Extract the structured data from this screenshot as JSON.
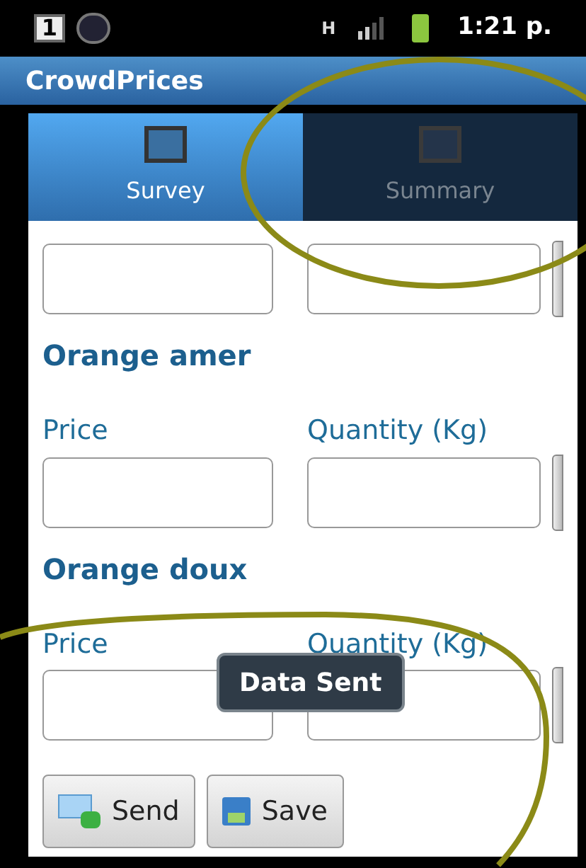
{
  "status_bar": {
    "notification_count": "1",
    "network": "H",
    "time": "1:21 p."
  },
  "app_bar": {
    "title": "CrowdPrices"
  },
  "tabs": [
    {
      "label": "Survey",
      "selected": true
    },
    {
      "label": "Summary",
      "selected": false
    }
  ],
  "sections": [
    {
      "fields": [
        {
          "kind": "price"
        },
        {
          "kind": "quantity"
        }
      ]
    },
    {
      "title": "Orange amer",
      "fields": [
        {
          "kind": "price",
          "label": "Price"
        },
        {
          "kind": "quantity",
          "label": "Quantity (Kg)"
        }
      ]
    },
    {
      "title": "Orange doux",
      "fields": [
        {
          "kind": "price",
          "label": "Price"
        },
        {
          "kind": "quantity",
          "label": "Quantity (Kg)"
        }
      ]
    }
  ],
  "toast": "Data Sent",
  "buttons": [
    {
      "kind": "send",
      "label": "Send"
    },
    {
      "kind": "save",
      "label": "Save"
    }
  ]
}
